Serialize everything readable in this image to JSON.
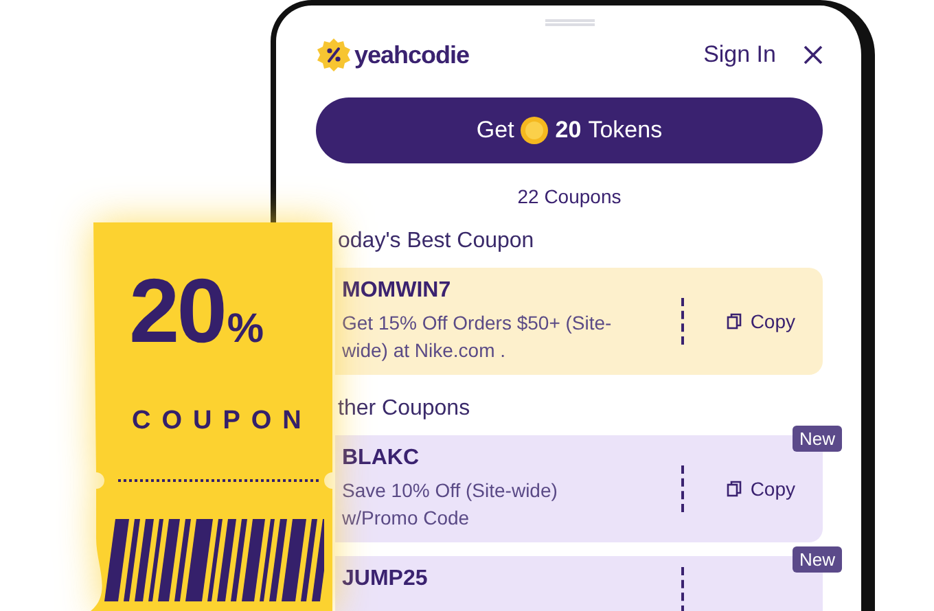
{
  "header": {
    "logo_text": "yeahcodie",
    "sign_in": "Sign In"
  },
  "tokens_button": {
    "prefix": "Get",
    "amount": "20",
    "suffix": "Tokens"
  },
  "coupon_count": "22 Coupons",
  "sections": [
    {
      "kind": "best",
      "heading": "oday's Best Coupon",
      "coupons": [
        {
          "code": "MOMWIN7",
          "description": "Get 15% Off Orders $50+ (Site-wide) at Nike.com .",
          "action": "Copy"
        }
      ]
    },
    {
      "kind": "other",
      "heading": "ther Coupons",
      "coupons": [
        {
          "code": "BLAKC",
          "description": "Save 10% Off (Site-wide) w/Promo Code",
          "action": "Copy",
          "badge": "New"
        },
        {
          "code": "JUMP25",
          "badge": "New"
        }
      ]
    }
  ],
  "ticket": {
    "value": "20",
    "unit": "%",
    "label": "COUPON"
  }
}
